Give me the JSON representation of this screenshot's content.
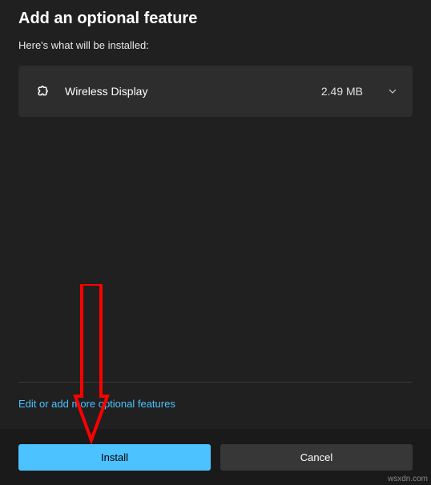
{
  "dialog": {
    "title": "Add an optional feature",
    "subtitle": "Here's what will be installed:",
    "edit_link": "Edit or add more optional features"
  },
  "features": [
    {
      "name": "Wireless Display",
      "size": "2.49 MB"
    }
  ],
  "footer": {
    "install_label": "Install",
    "cancel_label": "Cancel"
  },
  "watermark": "wsxdn.com"
}
